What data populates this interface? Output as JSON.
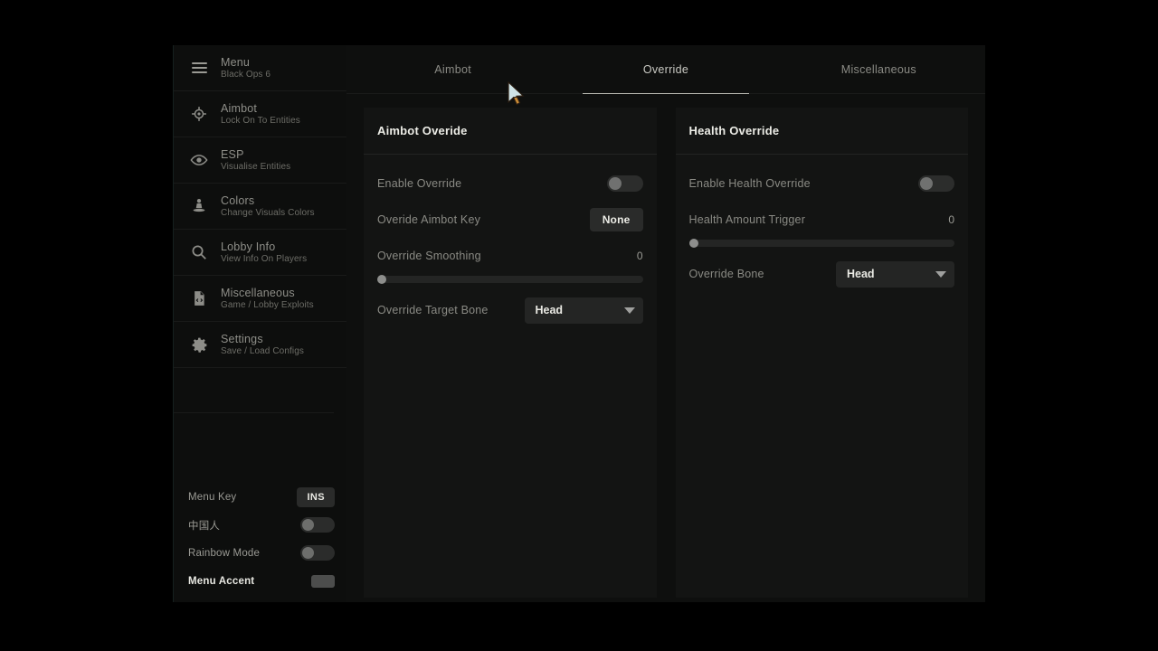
{
  "window": {
    "title": "Menu",
    "subtitle": "Black Ops 6"
  },
  "sidebar": {
    "menu_icon": "hamburger-icon",
    "items": [
      {
        "icon": "crosshair-icon",
        "title": "Aimbot",
        "sub": "Lock On To Entities"
      },
      {
        "icon": "eye-icon",
        "title": "ESP",
        "sub": "Visualise Entities"
      },
      {
        "icon": "person-color-icon",
        "title": "Colors",
        "sub": "Change Visuals Colors"
      },
      {
        "icon": "magnifier-icon",
        "title": "Lobby Info",
        "sub": "View Info On Players"
      },
      {
        "icon": "file-code-icon",
        "title": "Miscellaneous",
        "sub": "Game / Lobby Exploits"
      },
      {
        "icon": "gear-icon",
        "title": "Settings",
        "sub": "Save / Load Configs"
      }
    ],
    "watermark": "",
    "bottom": {
      "menu_key_label": "Menu Key",
      "menu_key_value": "INS",
      "chinese_label": "中国人",
      "chinese_enabled": "off",
      "rainbow_label": "Rainbow Mode",
      "rainbow_enabled": "off",
      "accent_label": "Menu Accent",
      "accent_color": "#4c4d4c"
    }
  },
  "tabs": [
    {
      "label": "Aimbot",
      "active": "false"
    },
    {
      "label": "Override",
      "active": "true"
    },
    {
      "label": "Miscellaneous",
      "active": "false"
    }
  ],
  "cards": {
    "aimbot_override": {
      "title": "Aimbot Overide",
      "enable_label": "Enable Override",
      "enable_state": "off",
      "key_label": "Overide Aimbot Key",
      "key_value": "None",
      "smoothing_label": "Override Smoothing",
      "smoothing_value": "0",
      "smoothing_percent": 0,
      "bone_label": "Override Target Bone",
      "bone_value": "Head"
    },
    "health_override": {
      "title": "Health Override",
      "enable_label": "Enable Health Override",
      "enable_state": "off",
      "trigger_label": "Health Amount Trigger",
      "trigger_value": "0",
      "trigger_percent": 0,
      "bone_label": "Override Bone",
      "bone_value": "Head"
    }
  }
}
